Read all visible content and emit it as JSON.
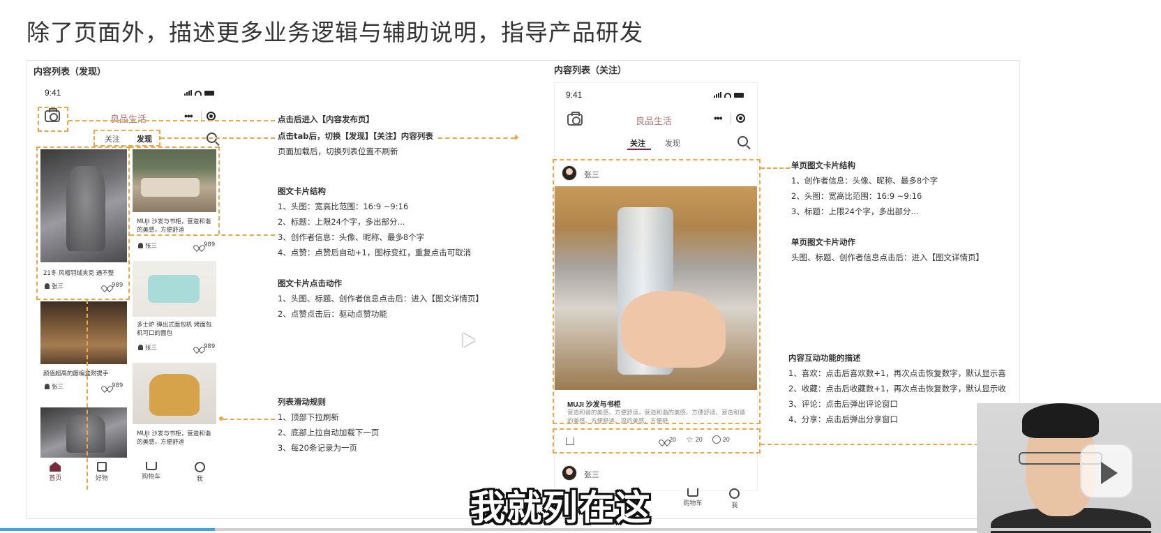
{
  "page": {
    "title": "除了页面外，描述更多业务逻辑与辅助说明，指导产品研发",
    "subtitle_overlay": "我就列在这",
    "video_progress": 0.185
  },
  "left_section": {
    "title": "内容列表（发现）",
    "phone": {
      "time": "9:41",
      "app_name": "良品生活",
      "tabs": [
        "关注",
        "发现"
      ],
      "active_tab": "发现",
      "cards_col1": [
        {
          "title": "21冬 风帽羽绒夹克 通不整",
          "author": "张三",
          "likes": "989"
        },
        {
          "title": "颜值超高的藤编盒附提手",
          "author": "张三",
          "likes": "989"
        }
      ],
      "cards_col2": [
        {
          "title": "MUJI 沙发与书柜，营造和谐的美感，方便舒适",
          "author": "张三",
          "likes": "989"
        },
        {
          "title": "多士炉 弹出式面包机 烤面包机可口的面包",
          "author": "张三",
          "likes": "989"
        },
        {
          "title": "MUJI 沙发与书柜，营造和谐的美感，方便舒适",
          "author": "",
          "likes": ""
        }
      ],
      "bottom_nav": [
        "首页",
        "好物",
        "购物车",
        "我"
      ]
    },
    "notes": {
      "camera": "点击后进入【内容发布页】",
      "tab_switch": "点击tab后，切换【发现】【关注】内容列表",
      "tab_switch_2": "页面加载后，切换列表位置不刷新",
      "card_structure_title": "图文卡片结构",
      "card_structure": [
        "1、头图：宽高比范围：16:9 ~9:16",
        "2、标题：上限24个字，多出部分...",
        "3、创作者信息：头像、昵称、最多8个字",
        "4、点赞：点赞后自动+1，图标变红，重复点击可取消"
      ],
      "card_action_title": "图文卡片点击动作",
      "card_action": [
        "1、头图、标题、创作者信息点击后：进入【图文详情页】",
        "2、点赞点击后：驱动点赞功能"
      ],
      "scroll_title": "列表滑动规则",
      "scroll": [
        "1、顶部下拉刷新",
        "2、底部上拉自动加载下一页",
        "3、每20条记录为一页"
      ]
    }
  },
  "right_section": {
    "title": "内容列表（关注）",
    "phone": {
      "time": "9:41",
      "app_name": "良品生活",
      "tabs": [
        "关注",
        "发现"
      ],
      "active_tab": "关注",
      "post_author": "张三",
      "post_title": "MUJI 沙发与书柜",
      "post_desc": "营造和谐的美感、方便舒适，营造和谐的美感、方便舒适、营造和谐的美感、方便舒适、温的美感、方便舒",
      "likes": "20",
      "favorites": "20",
      "comments": "20",
      "next_author": "张三",
      "bottom_nav": [
        "购物车",
        "我"
      ]
    },
    "notes": {
      "single_card_title": "单页图文卡片结构",
      "single_card": [
        "1、创作者信息：头像、昵称、最多8个字",
        "2、头图：宽高比范围：16:9 ~9:16",
        "3、标题：上限24个字，多出部分..."
      ],
      "single_action_title": "单页图文卡片动作",
      "single_action": "头图、标题、创作者信息点击后：进入【图文详情页】",
      "interact_title": "内容互动功能的描述",
      "interact": [
        "1、喜欢：点击后喜欢数+1，再次点击恢复数字，默认显示喜",
        "2、收藏：点击后收藏数+1，再次点击恢复数字，默认显示收",
        "3、评论：点击后弹出评论窗口",
        "4、分享：点击后弹出分享窗口"
      ]
    }
  },
  "colors": {
    "annotation": "#e8a84a",
    "brand": "#7a2a3a",
    "app_name": "#b07a7a"
  }
}
